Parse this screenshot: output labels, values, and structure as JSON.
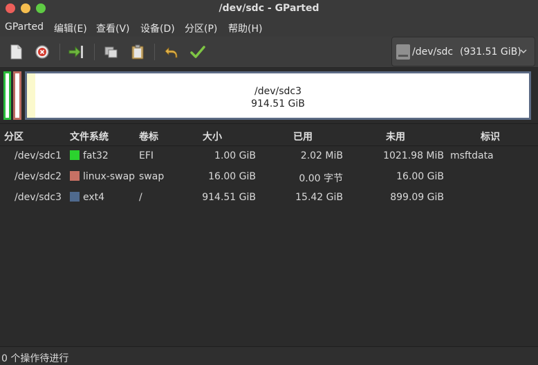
{
  "window": {
    "title": "/dev/sdc - GParted"
  },
  "menu": [
    "GParted",
    "编辑(E)",
    "查看(V)",
    "设备(D)",
    "分区(P)",
    "帮助(H)"
  ],
  "toolbar_icons": [
    "new-partition-icon",
    "delete-partition-icon",
    "resize-move-icon",
    "copy-icon",
    "paste-icon",
    "undo-icon",
    "apply-icon"
  ],
  "device_selector": {
    "name": "/dev/sdc",
    "size": "(931.51 GiB)"
  },
  "disk_map": {
    "selected_partition": "/dev/sdc3",
    "selected_size": "914.51 GiB"
  },
  "table": {
    "headers": [
      "分区",
      "文件系统",
      "卷标",
      "大小",
      "已用",
      "未用",
      "标识"
    ],
    "rows": [
      {
        "partition": "/dev/sdc1",
        "filesystem": "fat32",
        "fs_color": "#2bd32e",
        "label": "EFI",
        "size": "1.00 GiB",
        "used": "2.02 MiB",
        "unused": "1021.98 MiB",
        "flags": "msftdata"
      },
      {
        "partition": "/dev/sdc2",
        "filesystem": "linux-swap",
        "fs_color": "#c77164",
        "label": "swap",
        "size": "16.00 GiB",
        "used": "0.00 字节",
        "unused": "16.00 GiB",
        "flags": ""
      },
      {
        "partition": "/dev/sdc3",
        "filesystem": "ext4",
        "fs_color": "#4f6a8e",
        "label": "/",
        "size": "914.51 GiB",
        "used": "15.42 GiB",
        "unused": "899.09 GiB",
        "flags": ""
      }
    ]
  },
  "statusbar": {
    "text": "0 个操作待进行"
  }
}
